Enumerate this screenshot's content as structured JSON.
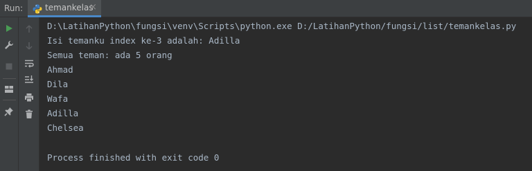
{
  "header": {
    "run_label": "Run:",
    "tab": {
      "label": "temankelas",
      "icon": "python-icon",
      "close_glyph": "×"
    }
  },
  "toolbar": {
    "outer": [
      "run-icon",
      "wrench-icon",
      "stop-icon",
      "layout-icon",
      "pin-icon"
    ],
    "inner": [
      "arrow-up-icon",
      "arrow-down-icon",
      "soft-wrap-icon",
      "scroll-to-end-icon",
      "print-icon",
      "trash-icon"
    ]
  },
  "console": {
    "lines": [
      "D:\\LatihanPython\\fungsi\\venv\\Scripts\\python.exe D:/LatihanPython/fungsi/list/temankelas.py",
      "Isi temanku index ke-3 adalah: Adilla",
      "Semua teman: ada 5 orang",
      "Ahmad",
      "Dila",
      "Wafa",
      "Adilla",
      "Chelsea",
      "",
      "Process finished with exit code 0"
    ]
  },
  "colors": {
    "background": "#2b2b2b",
    "panel": "#3c3f41",
    "text": "#a9b7c6",
    "accent": "#4a88c7",
    "run_green": "#499c54"
  }
}
